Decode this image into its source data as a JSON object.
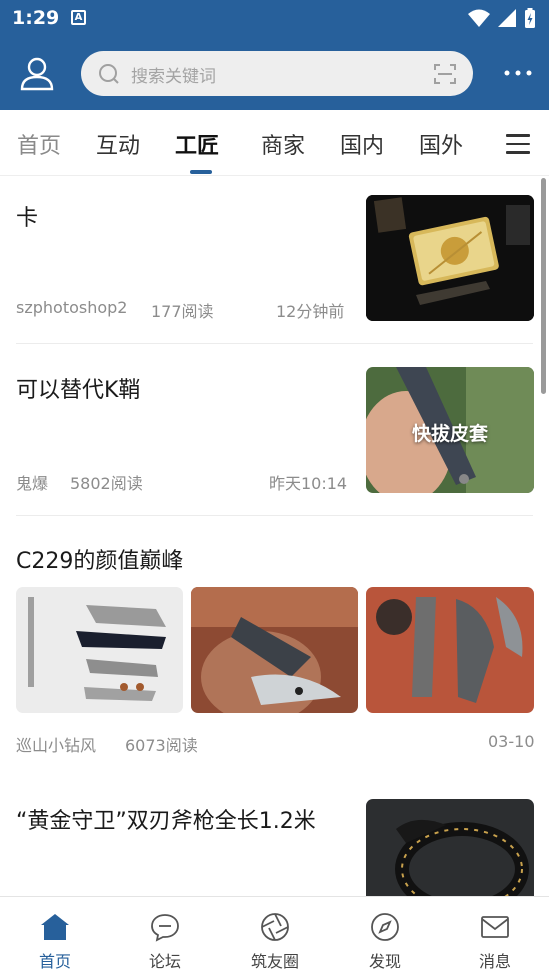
{
  "status_bar": {
    "time": "1:29",
    "notification_badge": "A"
  },
  "header": {
    "search_placeholder": "搜索关键词"
  },
  "tabs": [
    {
      "label": "首页",
      "active": false
    },
    {
      "label": "互动",
      "active": false
    },
    {
      "label": "工匠",
      "active": true
    },
    {
      "label": "商家",
      "active": false
    },
    {
      "label": "国内",
      "active": false
    },
    {
      "label": "国外",
      "active": false
    }
  ],
  "posts": [
    {
      "title": "卡",
      "author": "szphotoshop2",
      "reads": "177阅读",
      "time": "12分钟前"
    },
    {
      "title": "可以替代K鞘",
      "author": "鬼爆",
      "reads": "5802阅读",
      "time": "昨天10:14",
      "thumb_caption": "快拔皮套"
    },
    {
      "title": "C229的颜值巅峰",
      "author": "巡山小钻风",
      "reads": "6073阅读",
      "time": "03-10"
    },
    {
      "title": "“黄金守卫”双刃斧枪全长1.2米"
    }
  ],
  "bottom_nav": [
    {
      "label": "首页",
      "icon": "home-icon",
      "active": true
    },
    {
      "label": "论坛",
      "icon": "chat-bubble-icon",
      "active": false
    },
    {
      "label": "筑友圈",
      "icon": "camera-aperture-icon",
      "active": false
    },
    {
      "label": "发现",
      "icon": "compass-icon",
      "active": false
    },
    {
      "label": "消息",
      "icon": "envelope-icon",
      "active": false
    }
  ],
  "colors": {
    "brand": "#27609b",
    "active_tab_indicator": "#27609b",
    "meta_text": "#8c8c8c"
  }
}
